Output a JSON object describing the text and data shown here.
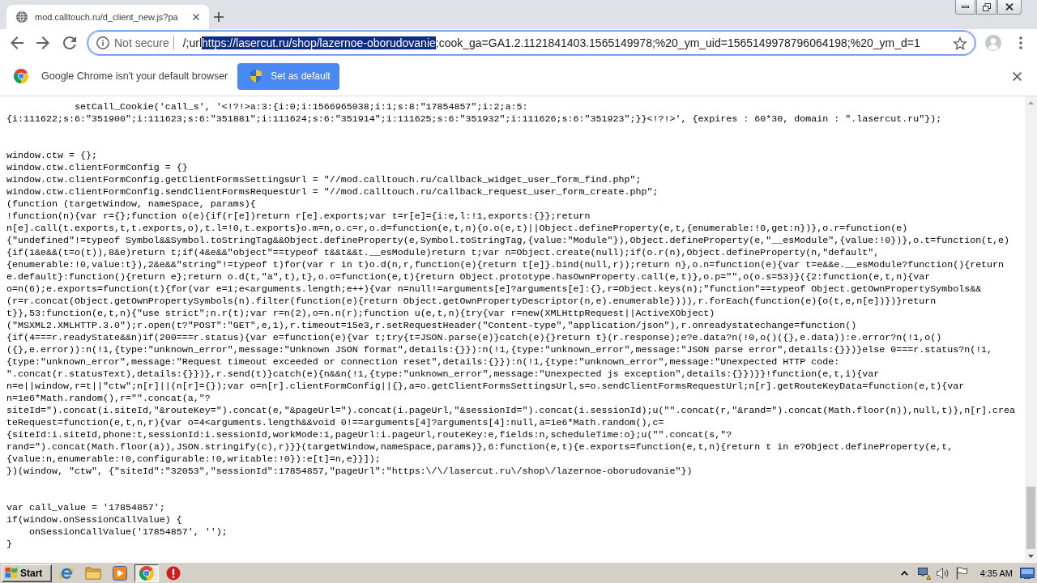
{
  "tabs": [
    {
      "title": "mod.calltouch.ru/d_client_new.js?pa",
      "selected": true
    }
  ],
  "address_bar": {
    "security_label": "Not secure",
    "url_before": "/;url",
    "url_selected": "https://lasercut.ru/shop/lazernoe-oborudovanie",
    "url_after": ";cook_ga=GA1.2.1121841403.1565149978;%20_ym_uid=1565149978796064198;%20_ym_d=1"
  },
  "infobar": {
    "message": "Google Chrome isn't your default browser",
    "button": "Set as default"
  },
  "page": {
    "code_blocks": [
      {
        "lines": [
          "            setCall_Cookie('call_s', '<!?!>a:3:{i:0;i:1566965038;i:1;s:8:\"17854857\";i:2;a:5:",
          "{i:111622;s:6:\"351900\";i:111623;s:6:\"351881\";i:111624;s:6:\"351914\";i:111625;s:6:\"351932\";i:111626;s:6:\"351923\";}}<!?!>', {expires : 60*30, domain : \".lasercut.ru\"});"
        ]
      },
      {
        "lines": [
          "window.ctw = {};",
          "window.ctw.clientFormConfig = {}",
          "window.ctw.clientFormConfig.getClientFormsSettingsUrl = \"//mod.calltouch.ru/callback_widget_user_form_find.php\";",
          "window.ctw.clientFormConfig.sendClientFormsRequestUrl = \"//mod.calltouch.ru/callback_request_user_form_create.php\";",
          "(function (targetWindow, nameSpace, params){",
          "!function(n){var r={};function o(e){if(r[e])return r[e].exports;var t=r[e]={i:e,l:!1,exports:{}};return",
          "n[e].call(t.exports,t,t.exports,o),t.l=!0,t.exports}o.m=n,o.c=r,o.d=function(e,t,n){o.o(e,t)||Object.defineProperty(e,t,{enumerable:!0,get:n})},o.r=function(e)",
          "{\"undefined\"!=typeof Symbol&&Symbol.toStringTag&&Object.defineProperty(e,Symbol.toStringTag,{value:\"Module\"}),Object.defineProperty(e,\"__esModule\",{value:!0})},o.t=function(t,e)",
          "{if(1&e&&(t=o(t)),8&e)return t;if(4&e&&\"object\"==typeof t&&t&&t.__esModule)return t;var n=Object.create(null);if(o.r(n),Object.defineProperty(n,\"default\",",
          "{enumerable:!0,value:t}),2&e&&\"string\"!=typeof t)for(var r in t)o.d(n,r,function(e){return t[e]}.bind(null,r));return n},o.n=function(e){var t=e&&e.__esModule?function(){return",
          "e.default}:function(){return e};return o.d(t,\"a\",t),t},o.o=function(e,t){return Object.prototype.hasOwnProperty.call(e,t)},o.p=\"\",o(o.s=53)}({2:function(e,t,n){var",
          "o=n(6);e.exports=function(t){for(var e=1;e<arguments.length;e++){var n=null!=arguments[e]?arguments[e]:{},r=Object.keys(n);\"function\"==typeof Object.getOwnPropertySymbols&&",
          "(r=r.concat(Object.getOwnPropertySymbols(n).filter(function(e){return Object.getOwnPropertyDescriptor(n,e).enumerable}))),r.forEach(function(e){o(t,e,n[e])})}return",
          "t}},53:function(e,t,n){\"use strict\";n.r(t);var r=n(2),o=n.n(r);function u(e,t,n){try{var r=new(XMLHttpRequest||ActiveXObject)",
          "(\"MSXML2.XMLHTTP.3.0\");r.open(t?\"POST\":\"GET\",e,1),r.timeout=15e3,r.setRequestHeader(\"Content-type\",\"application/json\"),r.onreadystatechange=function()",
          "{if(4===r.readyState&&n)if(200===r.status){var e=function(e){var t;try{t=JSON.parse(e)}catch(e){}return t}(r.response);e?e.data?n(!0,o()({},e.data)):e.error?n(!1,o()",
          "({},e.error)):n(!1,{type:\"unknown_error\",message:\"Unknown JSON format\",details:{}}):n(!1,{type:\"unknown_error\",message:\"JSON parse error\",details:{}})}else 0===r.status?n(!1,",
          "{type:\"unknown_error\",message:\"Request timeout exceeded or connection reset\",details:{}}):n(!1,{type:\"unknown_error\",message:\"Unexpected HTTP code:",
          "\".concat(r.statusText),details:{}})},r.send(t)}catch(e){n&&n(!1,{type:\"unknown_error\",message:\"Unexpected js exception\",details:{}})}}!function(e,t,i){var",
          "n=e||window,r=t||\"ctw\";n[r]||(n[r]={});var o=n[r].clientFormConfig||{},a=o.getClientFormsSettingsUrl,s=o.sendClientFormsRequestUrl;n[r].getRouteKeyData=function(e,t){var",
          "n=1e6*Math.random(),r=\"\".concat(a,\"?",
          "siteId=\").concat(i.siteId,\"&routeKey=\").concat(e,\"&pageUrl=\").concat(i.pageUrl,\"&sessionId=\").concat(i.sessionId);u(\"\".concat(r,\"&rand=\").concat(Math.floor(n)),null,t)},n[r].crea",
          "teRequest=function(e,t,n,r){var o=4<arguments.length&&void 0!==arguments[4]?arguments[4]:null,a=1e6*Math.random(),c=",
          "{siteId:i.siteId,phone:t,sessionId:i.sessionId,workMode:1,pageUrl:i.pageUrl,routeKey:e,fields:n,scheduleTime:o};u(\"\".concat(s,\"?",
          "rand=\").concat(Math.floor(a)),JSON.stringify(c),r)}}(targetWindow,nameSpace,params)},6:function(e,t){e.exports=function(e,t,n){return t in e?Object.defineProperty(e,t,",
          "{value:n,enumerable:!0,configurable:!0,writable:!0}):e[t]=n,e}}]);",
          "})(window, \"ctw\", {\"siteId\":\"32053\",\"sessionId\":17854857,\"pageUrl\":\"https:\\/\\/lasercut.ru\\/shop\\/lazernoe-oborudovanie\"})"
        ]
      },
      {
        "lines": [
          "var call_value = '17854857';",
          "if(window.onSessionCallValue) {",
          "    onSessionCallValue('17854857', '');",
          "}"
        ]
      }
    ]
  },
  "taskbar": {
    "start": "Start",
    "apps": [
      {
        "kind": "letter",
        "selected": false
      },
      {
        "kind": "folder",
        "selected": false
      },
      {
        "kind": "play",
        "selected": false
      },
      {
        "kind": "wheel",
        "selected": true
      },
      {
        "kind": "stop",
        "selected": false
      }
    ],
    "clock": "4:35 AM"
  }
}
